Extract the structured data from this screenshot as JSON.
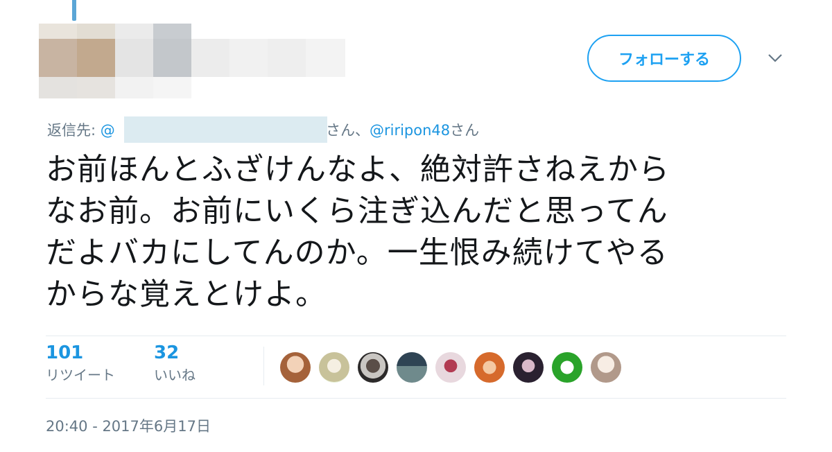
{
  "header": {
    "follow_label": "フォローする",
    "more_icon": "chevron-down-icon"
  },
  "reply": {
    "prefix": "返信先: ",
    "mention_start": "@",
    "suffix_1": "さん、",
    "mention_2": "@riripon48",
    "suffix_2": "さん"
  },
  "tweet": {
    "lines": [
      "お前ほんとふざけんなよ、絶対許さねえから",
      "なお前。お前にいくら注ぎ込んだと思ってん",
      "だよバカにしてんのか。一生恨み続けてやる",
      "からな覚えとけよ。"
    ]
  },
  "stats": {
    "retweets": "101",
    "retweets_label": "リツイート",
    "likes": "32",
    "likes_label": "いいね"
  },
  "timestamp": "20:40 - 2017年6月17日",
  "colors": {
    "accent": "#1da1f2",
    "mention": "#1b95e0",
    "muted": "#657786"
  }
}
